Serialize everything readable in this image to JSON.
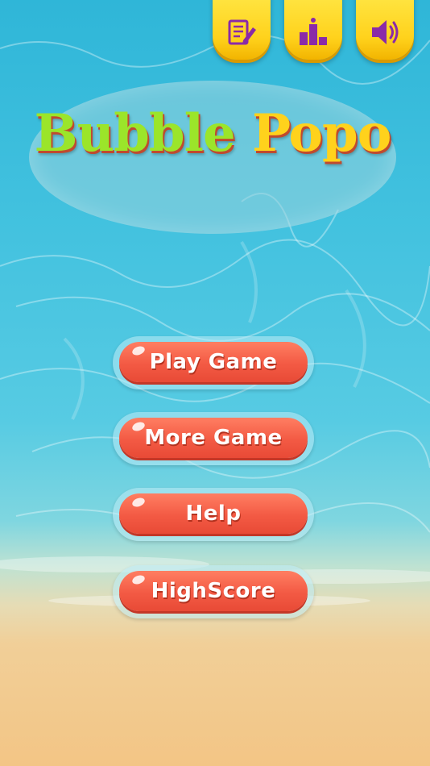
{
  "title": {
    "word1": "Bubble",
    "word2": "Popo"
  },
  "top_buttons": [
    {
      "icon": "notepad-edit-icon"
    },
    {
      "icon": "leaderboard-icon"
    },
    {
      "icon": "speaker-icon"
    }
  ],
  "menu": {
    "play": "Play Game",
    "more": "More Game",
    "help": "Help",
    "highscore": "HighScore"
  },
  "colors": {
    "title_green": "#9be52a",
    "title_yellow": "#ffd21c",
    "button_red": "#f35a44",
    "icon_purple": "#8a2aa8",
    "top_button_yellow": "#ffd21c"
  }
}
